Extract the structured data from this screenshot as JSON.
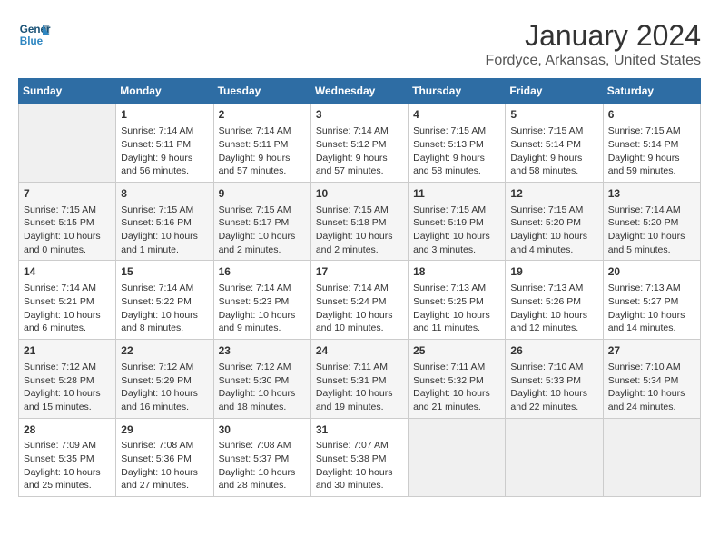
{
  "logo": {
    "line1": "General",
    "line2": "Blue"
  },
  "title": "January 2024",
  "subtitle": "Fordyce, Arkansas, United States",
  "header_days": [
    "Sunday",
    "Monday",
    "Tuesday",
    "Wednesday",
    "Thursday",
    "Friday",
    "Saturday"
  ],
  "weeks": [
    [
      {
        "day": "",
        "content": ""
      },
      {
        "day": "1",
        "content": "Sunrise: 7:14 AM\nSunset: 5:11 PM\nDaylight: 9 hours\nand 56 minutes."
      },
      {
        "day": "2",
        "content": "Sunrise: 7:14 AM\nSunset: 5:11 PM\nDaylight: 9 hours\nand 57 minutes."
      },
      {
        "day": "3",
        "content": "Sunrise: 7:14 AM\nSunset: 5:12 PM\nDaylight: 9 hours\nand 57 minutes."
      },
      {
        "day": "4",
        "content": "Sunrise: 7:15 AM\nSunset: 5:13 PM\nDaylight: 9 hours\nand 58 minutes."
      },
      {
        "day": "5",
        "content": "Sunrise: 7:15 AM\nSunset: 5:14 PM\nDaylight: 9 hours\nand 58 minutes."
      },
      {
        "day": "6",
        "content": "Sunrise: 7:15 AM\nSunset: 5:14 PM\nDaylight: 9 hours\nand 59 minutes."
      }
    ],
    [
      {
        "day": "7",
        "content": "Sunrise: 7:15 AM\nSunset: 5:15 PM\nDaylight: 10 hours\nand 0 minutes."
      },
      {
        "day": "8",
        "content": "Sunrise: 7:15 AM\nSunset: 5:16 PM\nDaylight: 10 hours\nand 1 minute."
      },
      {
        "day": "9",
        "content": "Sunrise: 7:15 AM\nSunset: 5:17 PM\nDaylight: 10 hours\nand 2 minutes."
      },
      {
        "day": "10",
        "content": "Sunrise: 7:15 AM\nSunset: 5:18 PM\nDaylight: 10 hours\nand 2 minutes."
      },
      {
        "day": "11",
        "content": "Sunrise: 7:15 AM\nSunset: 5:19 PM\nDaylight: 10 hours\nand 3 minutes."
      },
      {
        "day": "12",
        "content": "Sunrise: 7:15 AM\nSunset: 5:20 PM\nDaylight: 10 hours\nand 4 minutes."
      },
      {
        "day": "13",
        "content": "Sunrise: 7:14 AM\nSunset: 5:20 PM\nDaylight: 10 hours\nand 5 minutes."
      }
    ],
    [
      {
        "day": "14",
        "content": "Sunrise: 7:14 AM\nSunset: 5:21 PM\nDaylight: 10 hours\nand 6 minutes."
      },
      {
        "day": "15",
        "content": "Sunrise: 7:14 AM\nSunset: 5:22 PM\nDaylight: 10 hours\nand 8 minutes."
      },
      {
        "day": "16",
        "content": "Sunrise: 7:14 AM\nSunset: 5:23 PM\nDaylight: 10 hours\nand 9 minutes."
      },
      {
        "day": "17",
        "content": "Sunrise: 7:14 AM\nSunset: 5:24 PM\nDaylight: 10 hours\nand 10 minutes."
      },
      {
        "day": "18",
        "content": "Sunrise: 7:13 AM\nSunset: 5:25 PM\nDaylight: 10 hours\nand 11 minutes."
      },
      {
        "day": "19",
        "content": "Sunrise: 7:13 AM\nSunset: 5:26 PM\nDaylight: 10 hours\nand 12 minutes."
      },
      {
        "day": "20",
        "content": "Sunrise: 7:13 AM\nSunset: 5:27 PM\nDaylight: 10 hours\nand 14 minutes."
      }
    ],
    [
      {
        "day": "21",
        "content": "Sunrise: 7:12 AM\nSunset: 5:28 PM\nDaylight: 10 hours\nand 15 minutes."
      },
      {
        "day": "22",
        "content": "Sunrise: 7:12 AM\nSunset: 5:29 PM\nDaylight: 10 hours\nand 16 minutes."
      },
      {
        "day": "23",
        "content": "Sunrise: 7:12 AM\nSunset: 5:30 PM\nDaylight: 10 hours\nand 18 minutes."
      },
      {
        "day": "24",
        "content": "Sunrise: 7:11 AM\nSunset: 5:31 PM\nDaylight: 10 hours\nand 19 minutes."
      },
      {
        "day": "25",
        "content": "Sunrise: 7:11 AM\nSunset: 5:32 PM\nDaylight: 10 hours\nand 21 minutes."
      },
      {
        "day": "26",
        "content": "Sunrise: 7:10 AM\nSunset: 5:33 PM\nDaylight: 10 hours\nand 22 minutes."
      },
      {
        "day": "27",
        "content": "Sunrise: 7:10 AM\nSunset: 5:34 PM\nDaylight: 10 hours\nand 24 minutes."
      }
    ],
    [
      {
        "day": "28",
        "content": "Sunrise: 7:09 AM\nSunset: 5:35 PM\nDaylight: 10 hours\nand 25 minutes."
      },
      {
        "day": "29",
        "content": "Sunrise: 7:08 AM\nSunset: 5:36 PM\nDaylight: 10 hours\nand 27 minutes."
      },
      {
        "day": "30",
        "content": "Sunrise: 7:08 AM\nSunset: 5:37 PM\nDaylight: 10 hours\nand 28 minutes."
      },
      {
        "day": "31",
        "content": "Sunrise: 7:07 AM\nSunset: 5:38 PM\nDaylight: 10 hours\nand 30 minutes."
      },
      {
        "day": "",
        "content": ""
      },
      {
        "day": "",
        "content": ""
      },
      {
        "day": "",
        "content": ""
      }
    ]
  ]
}
